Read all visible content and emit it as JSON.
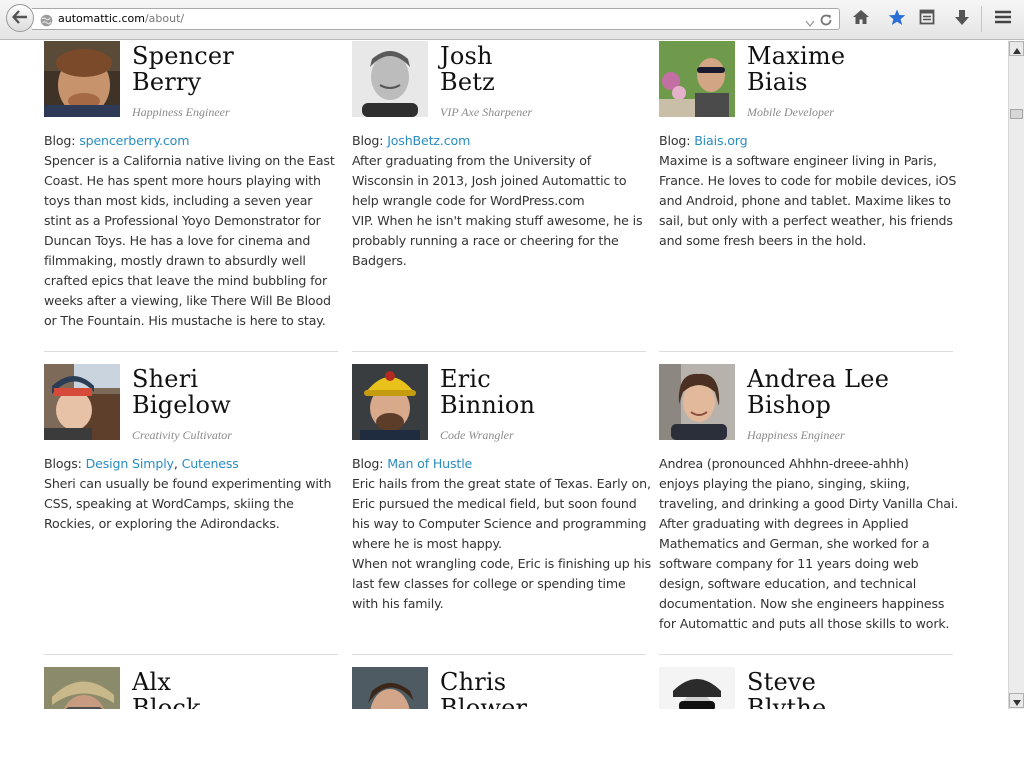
{
  "browser": {
    "url_host": "automattic.com",
    "url_path": "/about/",
    "icons": [
      "back-arrow-icon",
      "globe-icon",
      "dropdown-arrow-icon",
      "reload-icon",
      "home-icon",
      "bookmark-star-icon",
      "reading-list-icon",
      "download-icon",
      "menu-icon"
    ],
    "star_color": "#2b6ed6"
  },
  "people": [
    {
      "first": "Spencer",
      "last": "Berry",
      "role": "Happiness Engineer",
      "blog_label": "Blog: ",
      "blog_link": "spencerberry.com",
      "bio": [
        "Spencer is a California native living on the East",
        "Coast.  He has spent more hours playing with",
        "toys than most kids, including a seven year",
        "stint as a Professional Yoyo Demonstrator for",
        "Duncan Toys.  He has a love for cinema and",
        "filmmaking, mostly drawn to absurdly well",
        "crafted epics that leave the mind bubbling for",
        "weeks after a viewing, like There Will Be Blood",
        "or The Fountain.  His mustache is here to stay."
      ]
    },
    {
      "first": "Josh",
      "last": "Betz",
      "role": "VIP Axe Sharpener",
      "blog_label": "Blog: ",
      "blog_link": "JoshBetz.com",
      "bio": [
        "After graduating from the University of",
        "Wisconsin in 2013, Josh joined Automattic to",
        "help wrangle code for WordPress.com",
        "VIP. When he isn't making stuff awesome, he is",
        "probably running a race or cheering for the",
        "Badgers."
      ]
    },
    {
      "first": "Maxime",
      "last": "Biais",
      "role": "Mobile Developer",
      "blog_label": "Blog: ",
      "blog_link": "Biais.org",
      "bio": [
        "Maxime is a software engineer living in Paris,",
        "France. He loves to code for mobile devices, iOS",
        "and Android, phone and tablet. Maxime likes to",
        "sail, but only with a perfect weather, his friends",
        "and some fresh beers in the hold."
      ]
    },
    {
      "first": "Sheri",
      "last": "Bigelow",
      "role": "Creativity Cultivator",
      "blog_label": "Blogs: ",
      "blog_link": "Design Simply",
      "blog_sep": ", ",
      "blog_link2": "Cuteness",
      "bio": [
        "Sheri can usually be found experimenting with",
        "CSS, speaking at WordCamps, skiing the",
        "Rockies, or exploring the Adirondacks."
      ]
    },
    {
      "first": "Eric",
      "last": "Binnion",
      "role": "Code Wrangler",
      "blog_label": "Blog: ",
      "blog_link": "Man of Hustle",
      "bio": [
        "Eric hails from the great state of Texas. Early on,",
        "Eric pursued the medical field, but soon found",
        "his way to Computer Science and programming",
        "where he is most happy.",
        "When not wrangling code, Eric is finishing up his",
        "last few classes for college or spending time",
        "with his family."
      ]
    },
    {
      "first": "Andrea Lee",
      "last": "Bishop",
      "role": "Happiness Engineer",
      "bio": [
        "Andrea (pronounced Ahhhn-dreee-ahhh)",
        "enjoys playing the piano, singing, skiing,",
        "traveling, and drinking a good Dirty Vanilla Chai.",
        "After graduating with degrees in Applied",
        "Mathematics and German, she worked for a",
        "software company for 11 years doing web",
        "design, software education, and technical",
        "documentation. Now she engineers happiness",
        "for Automattic and puts all those skills to work."
      ]
    },
    {
      "first": "Alx",
      "last": "Block"
    },
    {
      "first": "Chris",
      "last": "Blower"
    },
    {
      "first": "Steve",
      "last": "Blythe"
    }
  ]
}
